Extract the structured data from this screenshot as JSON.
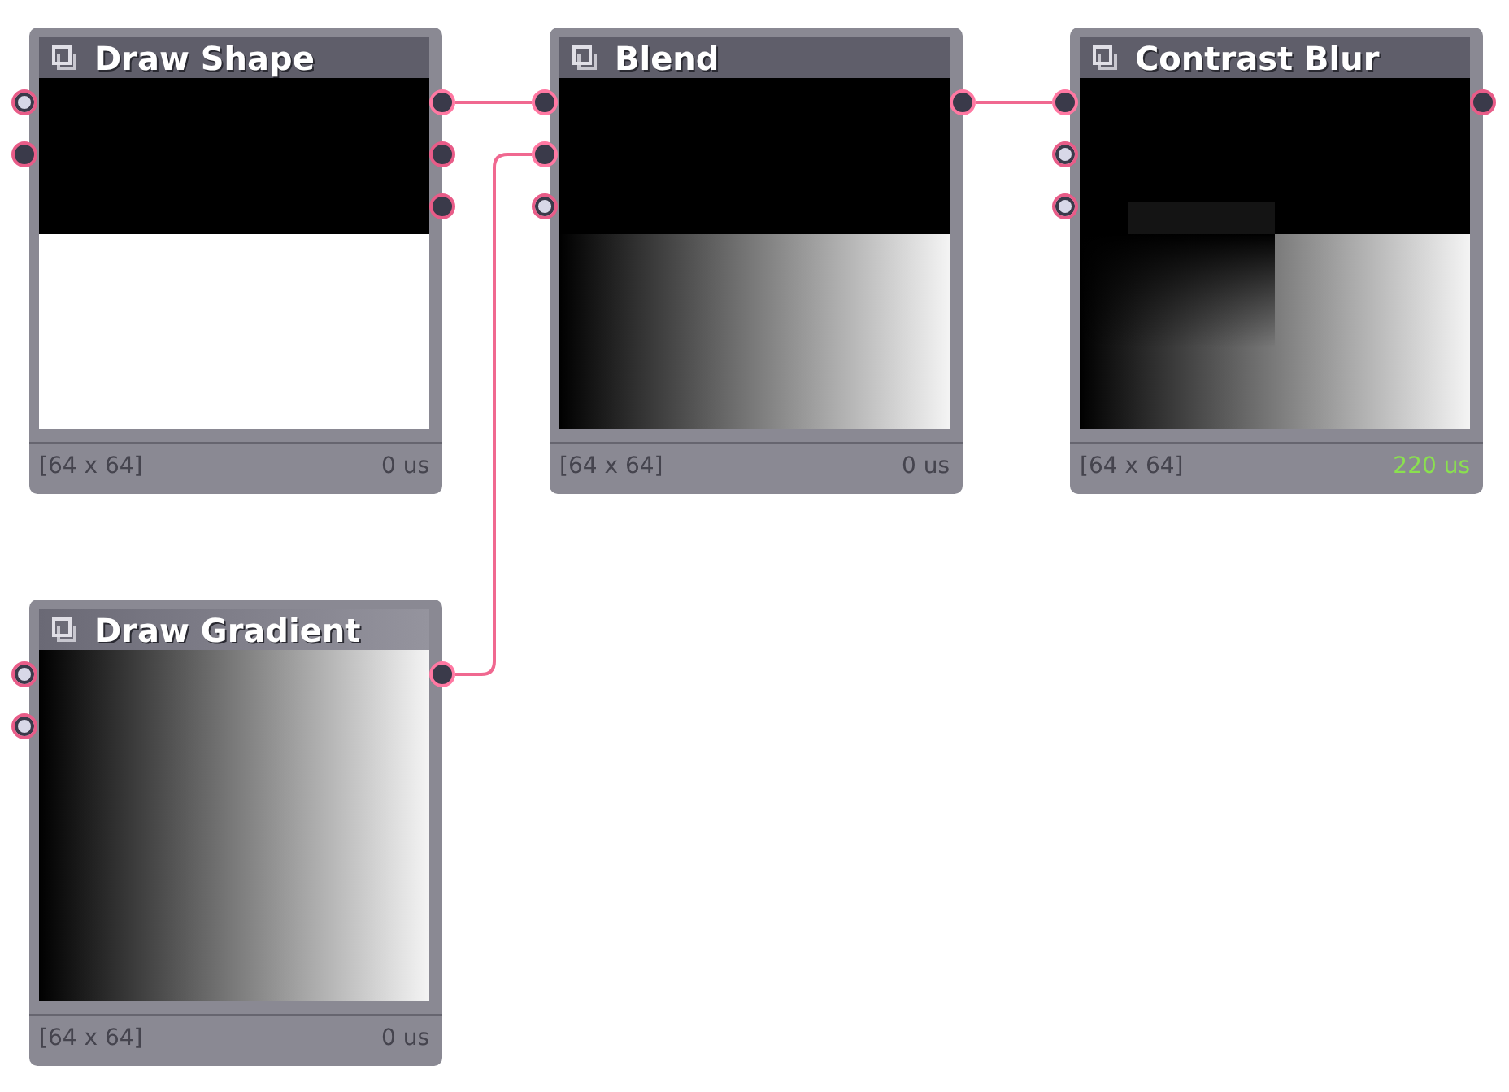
{
  "nodes": [
    {
      "title": "Draw Shape",
      "selected": false,
      "kind": "shape",
      "size": "[64 x 64]",
      "time": "0 us",
      "time_highlight": false,
      "inputs": [
        {
          "kind": "value",
          "connected": false
        },
        {
          "kind": "image",
          "connected": false
        }
      ],
      "outputs": [
        {
          "kind": "image",
          "connected": true
        },
        {
          "kind": "image",
          "connected": false
        },
        {
          "kind": "image",
          "connected": false
        }
      ]
    },
    {
      "title": "Blend",
      "selected": false,
      "kind": "blend",
      "size": "[64 x 64]",
      "time": "0 us",
      "time_highlight": false,
      "inputs": [
        {
          "kind": "image",
          "connected": true
        },
        {
          "kind": "image",
          "connected": true
        },
        {
          "kind": "value",
          "connected": false
        }
      ],
      "outputs": [
        {
          "kind": "image",
          "connected": true
        }
      ]
    },
    {
      "title": "Contrast Blur",
      "selected": false,
      "kind": "blur",
      "size": "[64 x 64]",
      "time": "220 us",
      "time_highlight": true,
      "inputs": [
        {
          "kind": "image",
          "connected": true
        },
        {
          "kind": "value",
          "connected": false
        },
        {
          "kind": "value",
          "connected": false
        }
      ],
      "outputs": [
        {
          "kind": "image",
          "connected": false
        }
      ]
    },
    {
      "title": "Draw Gradient",
      "selected": true,
      "kind": "gradient",
      "size": "[64 x 64]",
      "time": "0 us",
      "time_highlight": false,
      "inputs": [
        {
          "kind": "value",
          "connected": false
        },
        {
          "kind": "value",
          "connected": false
        }
      ],
      "outputs": [
        {
          "kind": "image",
          "connected": true
        }
      ]
    }
  ]
}
